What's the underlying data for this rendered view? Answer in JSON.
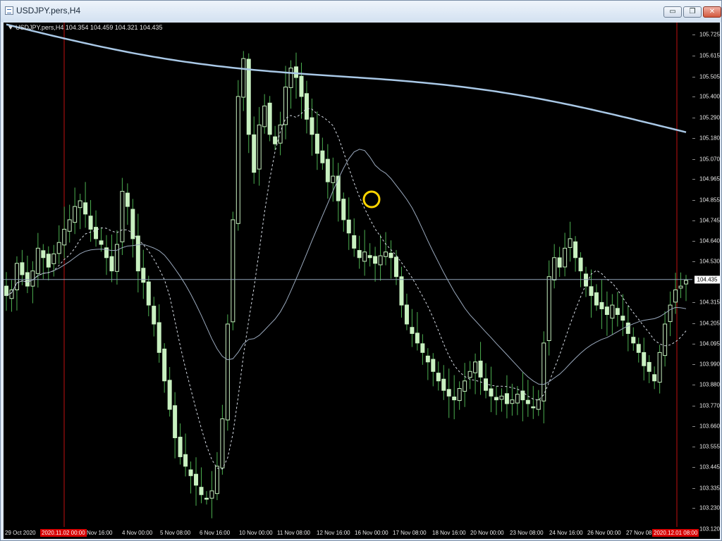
{
  "window": {
    "title": "USDJPY.pers,H4",
    "controls": {
      "minimize": "▭",
      "restore": "❐",
      "close": "✕"
    }
  },
  "header": {
    "symbol_line": "USDJPY.pers,H4  104.354 104.459 104.321 104.435"
  },
  "colors": {
    "background": "#000000",
    "candle": "#c8f0c0",
    "wick": "#4caf50",
    "ma_slow": "#a9c8e6",
    "ma_mid": "#9aa9bd",
    "ma_fast": "#d7dde6",
    "bid_line": "#8fa3b8",
    "period_separator": "#c01010",
    "highlight_circle": "#ffd500"
  },
  "price_axis": {
    "min": 103.13,
    "max": 105.79,
    "labels": [
      "105.725",
      "105.615",
      "105.505",
      "105.400",
      "105.290",
      "105.180",
      "105.070",
      "104.965",
      "104.855",
      "104.745",
      "104.640",
      "104.530",
      "104.315",
      "104.205",
      "104.095",
      "103.990",
      "103.880",
      "103.770",
      "103.660",
      "103.555",
      "103.445",
      "103.335",
      "103.230",
      "103.120"
    ],
    "current_bid": "104.435"
  },
  "time_axis": {
    "labels": [
      "29 Oct 2020",
      "Nov 16:00",
      "4 Nov 00:00",
      "5 Nov 08:00",
      "6 Nov 16:00",
      "10 Nov 00:00",
      "11 Nov 08:00",
      "12 Nov 16:00",
      "16 Nov 00:00",
      "17 Nov 08:00",
      "18 Nov 16:00",
      "20 Nov 00:00",
      "23 Nov 08:00",
      "24 Nov 16:00",
      "26 Nov 00:00",
      "27 Nov 08"
    ],
    "start_marker": "2020.11.02 00:00",
    "end_marker": "2020.12.01 08:00"
  },
  "chart_data": {
    "type": "candlestick",
    "symbol": "USDJPY.pers",
    "timeframe": "H4",
    "last_bar": {
      "open": 104.354,
      "high": 104.459,
      "low": 104.321,
      "close": 104.435
    },
    "closes": [
      104.35,
      104.38,
      104.52,
      104.46,
      104.4,
      104.48,
      104.6,
      104.55,
      104.5,
      104.57,
      104.63,
      104.7,
      104.75,
      104.82,
      104.85,
      104.78,
      104.7,
      104.65,
      104.62,
      104.55,
      104.48,
      104.62,
      104.9,
      104.82,
      104.65,
      104.48,
      104.42,
      104.3,
      104.2,
      104.05,
      103.9,
      103.75,
      103.6,
      103.5,
      103.45,
      103.4,
      103.35,
      103.3,
      103.28,
      103.32,
      103.45,
      103.7,
      104.2,
      104.75,
      105.4,
      105.6,
      105.2,
      105.0,
      105.25,
      105.35,
      105.2,
      105.15,
      105.25,
      105.45,
      105.55,
      105.5,
      105.4,
      105.28,
      105.2,
      105.1,
      105.05,
      104.95,
      104.98,
      104.85,
      104.75,
      104.68,
      104.6,
      104.55,
      104.58,
      104.55,
      104.52,
      104.56,
      104.58,
      104.55,
      104.45,
      104.3,
      104.2,
      104.15,
      104.1,
      104.05,
      104.0,
      103.95,
      103.9,
      103.85,
      103.82,
      103.8,
      103.86,
      103.9,
      103.95,
      104.0,
      103.92,
      103.85,
      103.82,
      103.8,
      103.82,
      103.78,
      103.8,
      103.83,
      103.8,
      103.78,
      103.76,
      103.8,
      104.1,
      104.45,
      104.55,
      104.5,
      104.6,
      104.65,
      104.55,
      104.48,
      104.4,
      104.35,
      104.3,
      104.28,
      104.25,
      104.3,
      104.25,
      104.22,
      104.15,
      104.1,
      104.05,
      103.98,
      103.95,
      103.9,
      104.05,
      104.2,
      104.3,
      104.38,
      104.4,
      104.43
    ],
    "moving_averages": [
      {
        "style": "solid-thick",
        "color": "#a9c8e6"
      },
      {
        "style": "solid-thin",
        "color": "#9aa9bd"
      },
      {
        "style": "dashed",
        "color": "#d7dde6"
      }
    ],
    "grid": false
  }
}
